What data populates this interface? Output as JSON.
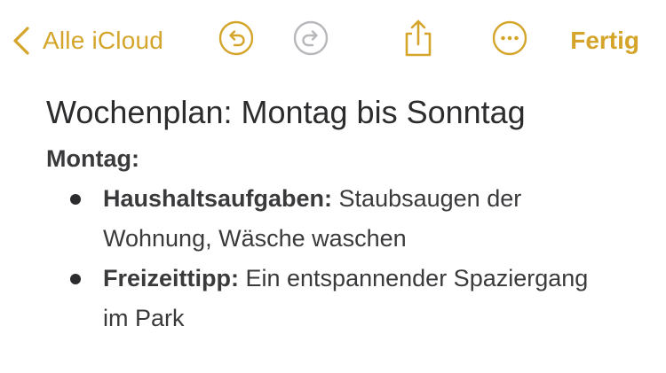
{
  "toolbar": {
    "back_label": "Alle iCloud",
    "back_icon": "chevron-left-icon",
    "undo_icon": "undo-icon",
    "redo_icon": "redo-icon",
    "share_icon": "share-icon",
    "more_icon": "ellipsis-icon",
    "done_label": "Fertig",
    "accent_color": "#d4a52a",
    "disabled_color": "#b8b8bc"
  },
  "note": {
    "title": "Wochenplan: Montag bis Sonntag",
    "sections": [
      {
        "heading": "Montag:",
        "items": [
          {
            "term": "Haushaltsaufgaben:",
            "text": " Staubsaugen der Wohnung, Wäsche waschen"
          },
          {
            "term": "Freizeittipp:",
            "text": " Ein entspannender Spaziergang im Park"
          }
        ]
      }
    ]
  }
}
